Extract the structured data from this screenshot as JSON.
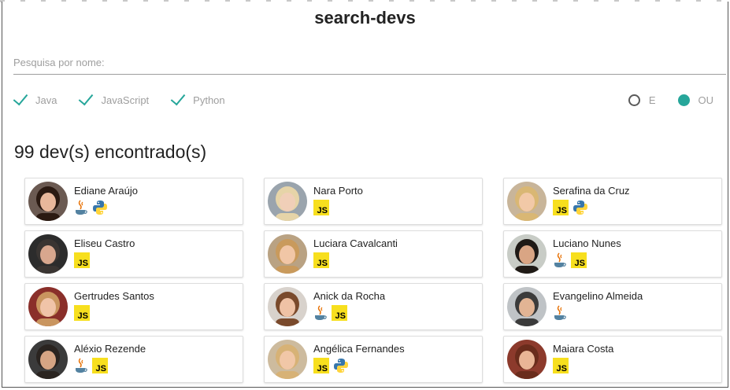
{
  "app": {
    "title": "search-devs"
  },
  "search": {
    "placeholder": "Pesquisa por nome:",
    "value": ""
  },
  "filters": {
    "languages": [
      {
        "label": "Java",
        "checked": true
      },
      {
        "label": "JavaScript",
        "checked": true
      },
      {
        "label": "Python",
        "checked": true
      }
    ],
    "mode": [
      {
        "label": "E",
        "selected": false
      },
      {
        "label": "OU",
        "selected": true
      }
    ]
  },
  "results": {
    "count_text": "99 dev(s) encontrado(s)",
    "devs": [
      {
        "name": "Ediane Araújo",
        "techs": [
          "java",
          "python"
        ],
        "avatar": {
          "hair": "#2b1a12",
          "skin": "#e8b79b",
          "bg": "#6b5a52"
        }
      },
      {
        "name": "Nara Porto",
        "techs": [
          "javascript"
        ],
        "avatar": {
          "hair": "#e6d4a8",
          "skin": "#f0cfb8",
          "bg": "#9aa4ad"
        }
      },
      {
        "name": "Serafina da Cruz",
        "techs": [
          "javascript",
          "python"
        ],
        "avatar": {
          "hair": "#d9b774",
          "skin": "#f2c9a7",
          "bg": "#c8b59a"
        }
      },
      {
        "name": "Eliseu Castro",
        "techs": [
          "javascript"
        ],
        "avatar": {
          "hair": "#3a3532",
          "skin": "#d8a78e",
          "bg": "#2c2c2c"
        }
      },
      {
        "name": "Luciara Cavalcanti",
        "techs": [
          "javascript"
        ],
        "avatar": {
          "hair": "#c99a5c",
          "skin": "#f1c6a6",
          "bg": "#b9a283"
        }
      },
      {
        "name": "Luciano Nunes",
        "techs": [
          "java",
          "javascript"
        ],
        "avatar": {
          "hair": "#1f1a16",
          "skin": "#d9a584",
          "bg": "#c8ccc6"
        }
      },
      {
        "name": "Gertrudes Santos",
        "techs": [
          "javascript"
        ],
        "avatar": {
          "hair": "#c9955f",
          "skin": "#f0c4a8",
          "bg": "#8a2f2a"
        }
      },
      {
        "name": "Anick da Rocha",
        "techs": [
          "java",
          "javascript"
        ],
        "avatar": {
          "hair": "#7a4a2c",
          "skin": "#efc2a5",
          "bg": "#d8d2cc"
        }
      },
      {
        "name": "Evangelino Almeida",
        "techs": [
          "java"
        ],
        "avatar": {
          "hair": "#3b3b3b",
          "skin": "#e2b494",
          "bg": "#bfc3c6"
        }
      },
      {
        "name": "Aléxio Rezende",
        "techs": [
          "java",
          "javascript"
        ],
        "avatar": {
          "hair": "#2a2420",
          "skin": "#d6a584",
          "bg": "#3b3b3b"
        }
      },
      {
        "name": "Angélica Fernandes",
        "techs": [
          "javascript",
          "python"
        ],
        "avatar": {
          "hair": "#d7b276",
          "skin": "#f1c7a7",
          "bg": "#cdbb9e"
        }
      },
      {
        "name": "Maiara Costa",
        "techs": [
          "javascript"
        ],
        "avatar": {
          "hair": "#6a2c1c",
          "skin": "#e9b596",
          "bg": "#8c3a2c"
        }
      }
    ]
  },
  "colors": {
    "accent": "#26a69a",
    "js_badge": "#f7df1e",
    "java_cup": "#e76f00",
    "java_steam": "#5382a1",
    "python_blue": "#3776ab",
    "python_yellow": "#ffd43b"
  }
}
